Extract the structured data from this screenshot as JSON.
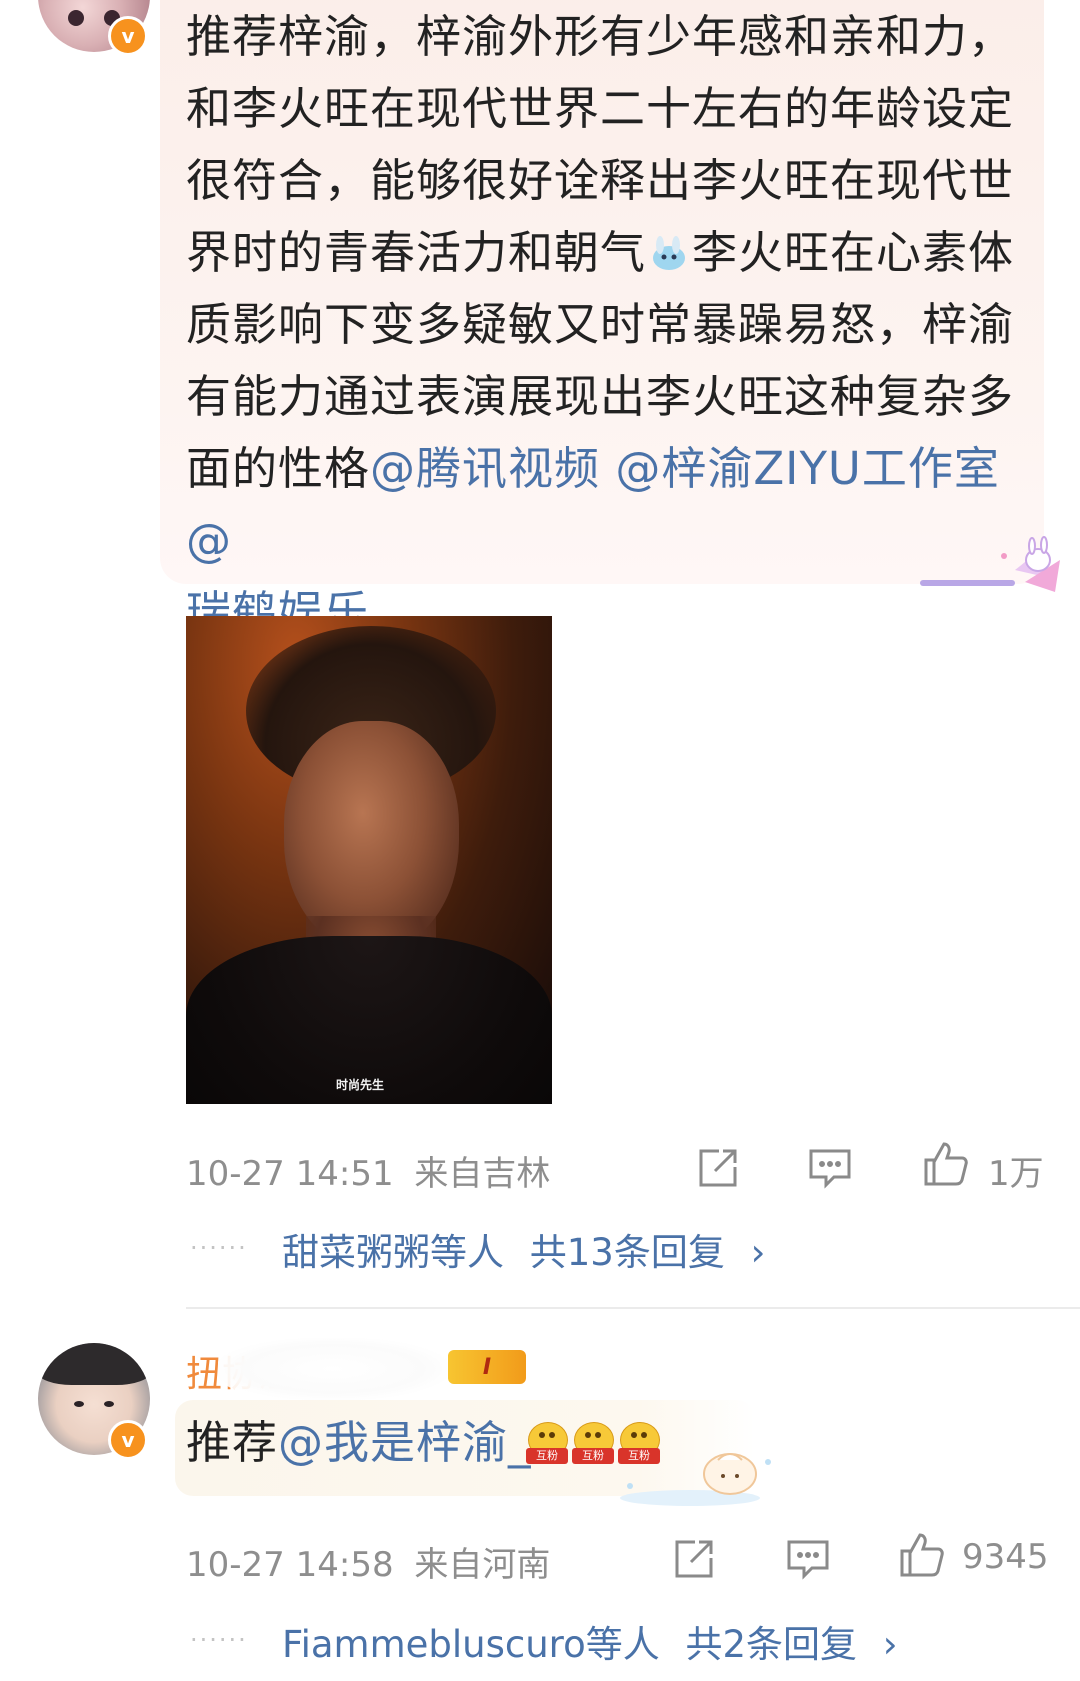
{
  "comment1": {
    "text_lines": [
      "推荐梓渝，梓渝外形有少年感和亲和力，",
      "和李火旺在现代世界二十左右的年龄设定",
      "很符合，能够很好诠释出李火旺在现代世",
      "界时的青春活力和朝气",
      "李火旺在心素体",
      "质影响下变多疑敏又时常暴躁易怒，梓渝",
      "有能力通过表演展现出李火旺这种复杂多",
      "面的性格"
    ],
    "mentions": [
      "@腾讯视频",
      "@梓渝ZIYU工作室",
      "@",
      "瑞鹤娱乐"
    ],
    "image_watermark": "时尚先生",
    "timestamp": "10-27 14:51",
    "location": "来自吉林",
    "like_count": "1万",
    "replies_by": "甜菜粥粥等人",
    "replies_count": "共13条回复",
    "replies_arrow": "›",
    "avatar_badge": "v"
  },
  "comment2": {
    "username_visible": "扭协淦纳",
    "level_badge": "I",
    "text_prefix": "推荐",
    "mention": "@我是梓渝_",
    "emoji_label": "互粉",
    "timestamp": "10-27 14:58",
    "location": "来自河南",
    "like_count": "9345",
    "replies_by": "Fiammebluscuro等人",
    "replies_count": "共2条回复",
    "replies_arrow": "›",
    "avatar_badge": "v"
  },
  "reply_dots": "······",
  "icons": [
    "share-icon",
    "comment-icon",
    "like-icon"
  ],
  "colors": {
    "mention": "#4a72a8",
    "meta": "#8e8e8e",
    "badge": "#f7921e",
    "username": "#f08a3c"
  }
}
